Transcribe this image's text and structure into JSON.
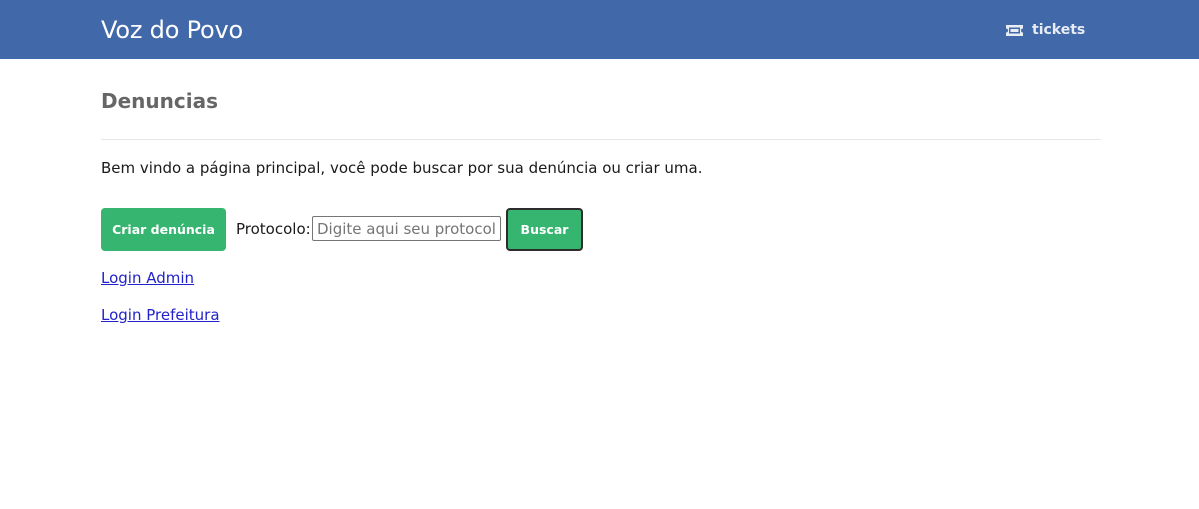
{
  "navbar": {
    "brand": "Voz do Povo",
    "tickets_label": "tickets",
    "tickets_icon": "ticket-icon",
    "background": "#4169aa"
  },
  "page": {
    "title": "Denuncias",
    "intro": "Bem vindo a página principal, você pode buscar por sua denúncia ou criar uma."
  },
  "actions": {
    "create_label": "Criar denúncia",
    "protocol_label": "Protocolo:",
    "protocol_placeholder": "Digite aqui seu protocolo",
    "protocol_value": "",
    "search_label": "Buscar",
    "button_color": "#35b56f"
  },
  "links": {
    "admin_login": "Login Admin",
    "city_login": "Login Prefeitura"
  }
}
